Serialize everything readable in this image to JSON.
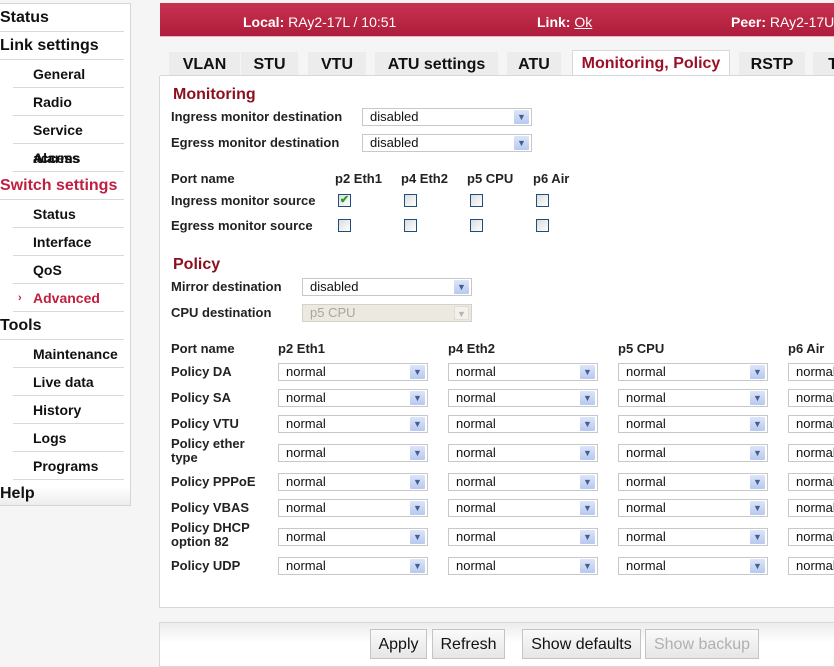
{
  "sidebar": {
    "items": [
      {
        "label": "Status",
        "level": "top"
      },
      {
        "label": "Link settings",
        "level": "top"
      },
      {
        "label": "General",
        "level": "sub"
      },
      {
        "label": "Radio",
        "level": "sub"
      },
      {
        "label": "Service access",
        "level": "sub"
      },
      {
        "label": "Alarms",
        "level": "sub"
      },
      {
        "label": "Switch settings",
        "level": "top",
        "active": true
      },
      {
        "label": "Status",
        "level": "sub"
      },
      {
        "label": "Interface",
        "level": "sub"
      },
      {
        "label": "QoS",
        "level": "sub"
      },
      {
        "label": "Advanced",
        "level": "sub",
        "active": true,
        "icon": "chevron-right-icon"
      },
      {
        "label": "Tools",
        "level": "top"
      },
      {
        "label": "Maintenance",
        "level": "sub"
      },
      {
        "label": "Live data",
        "level": "sub"
      },
      {
        "label": "History",
        "level": "sub"
      },
      {
        "label": "Logs",
        "level": "sub"
      },
      {
        "label": "Programs",
        "level": "sub"
      },
      {
        "label": "Help",
        "level": "top"
      }
    ]
  },
  "header": {
    "local_label": "Local:",
    "local_value": "RAy2-17L / 10:51",
    "link_label": "Link:",
    "link_value": "Ok",
    "peer_label": "Peer:",
    "peer_value": "RAy2-17U"
  },
  "tabs": [
    {
      "label": "VLAN"
    },
    {
      "label": "STU"
    },
    {
      "label": "VTU"
    },
    {
      "label": "ATU settings"
    },
    {
      "label": "ATU"
    },
    {
      "label": "Monitoring, Policy",
      "active": true
    },
    {
      "label": "RSTP"
    },
    {
      "label": "T"
    }
  ],
  "monitoring": {
    "title": "Monitoring",
    "ingress_dest_label": "Ingress monitor destination",
    "ingress_dest_value": "disabled",
    "egress_dest_label": "Egress monitor destination",
    "egress_dest_value": "disabled",
    "port_name_label": "Port name",
    "ports": [
      "p2 Eth1",
      "p4 Eth2",
      "p5 CPU",
      "p6 Air"
    ],
    "ingress_source_label": "Ingress monitor source",
    "ingress_source": [
      true,
      false,
      false,
      false
    ],
    "egress_source_label": "Egress monitor source",
    "egress_source": [
      false,
      false,
      false,
      false
    ]
  },
  "policy": {
    "title": "Policy",
    "mirror_dest_label": "Mirror destination",
    "mirror_dest_value": "disabled",
    "cpu_dest_label": "CPU destination",
    "cpu_dest_value": "p5 CPU",
    "port_name_label": "Port name",
    "ports": [
      "p2 Eth1",
      "p4 Eth2",
      "p5 CPU",
      "p6 Air"
    ],
    "rows": [
      {
        "label": "Policy DA",
        "values": [
          "normal",
          "normal",
          "normal",
          "normal"
        ]
      },
      {
        "label": "Policy SA",
        "values": [
          "normal",
          "normal",
          "normal",
          "normal"
        ]
      },
      {
        "label": "Policy VTU",
        "values": [
          "normal",
          "normal",
          "normal",
          "normal"
        ]
      },
      {
        "label": "Policy ether type",
        "values": [
          "normal",
          "normal",
          "normal",
          "normal"
        ]
      },
      {
        "label": "Policy PPPoE",
        "values": [
          "normal",
          "normal",
          "normal",
          "normal"
        ]
      },
      {
        "label": "Policy VBAS",
        "values": [
          "normal",
          "normal",
          "normal",
          "normal"
        ]
      },
      {
        "label": "Policy DHCP option 82",
        "values": [
          "normal",
          "normal",
          "normal",
          "normal"
        ]
      },
      {
        "label": "Policy UDP",
        "values": [
          "normal",
          "normal",
          "normal",
          "normal"
        ]
      }
    ]
  },
  "footer": {
    "apply": "Apply",
    "refresh": "Refresh",
    "show_defaults": "Show defaults",
    "show_backup": "Show backup"
  },
  "colors": {
    "accent": "#c0203f",
    "header_bar": "#b9223f",
    "section_title": "#8b0f1f"
  }
}
